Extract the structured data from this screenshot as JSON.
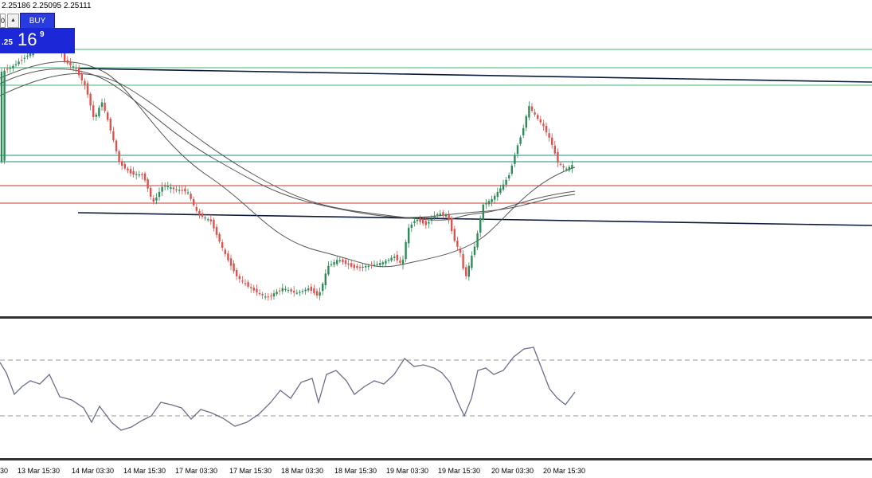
{
  "quote_line": "2.25186 2.25095 2.25111",
  "trade_panel": {
    "lot_value": "0",
    "arrow_glyph": "▲",
    "buy_label": "BUY",
    "price_small": ".25",
    "price_big": "16",
    "price_sup": "9"
  },
  "colors": {
    "bull_candle": "#2e8b57",
    "bear_candle": "#d9534f",
    "horizontal_green": "#3cb371",
    "horizontal_teal": "#1f8a8a",
    "horizontal_red": "#c0392b",
    "trendline": "#0b1a3a",
    "moving_average": "#555555",
    "oscillator": "#6a6f8a",
    "oscillator_levels": "#9a9a9a",
    "separator": "#333333"
  },
  "time_axis": {
    "labels": [
      "30",
      "13 Mar 15:30",
      "14 Mar 03:30",
      "14 Mar 15:30",
      "17 Mar 03:30",
      "17 Mar 15:30",
      "18 Mar 03:30",
      "18 Mar 15:30",
      "19 Mar 03:30",
      "19 Mar 15:30",
      "20 Mar 03:30",
      "20 Mar 15:30"
    ]
  },
  "chart_data": {
    "type": "candlestick",
    "horizontal_levels": {
      "green": 3,
      "teal": 2,
      "red": 2
    },
    "trendlines": 2,
    "moving_averages": 3,
    "oscillator": {
      "levels": 2,
      "shape": "oscillating line, lowest around 17 Mar 15:30, highest around 20 Mar 03:30"
    }
  }
}
